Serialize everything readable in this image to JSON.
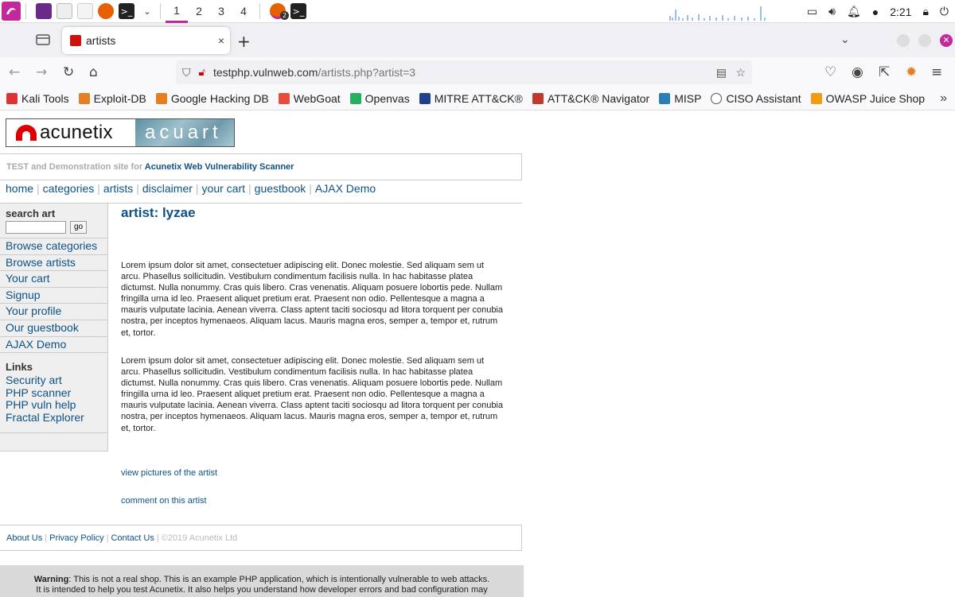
{
  "taskbar": {
    "workspaces": [
      "1",
      "2",
      "3",
      "4"
    ],
    "firefox_badge": "2",
    "clock": "2:21"
  },
  "browser": {
    "tab_title": "artists",
    "tab_close": "×",
    "new_tab": "+",
    "url_host": "testphp.vulnweb.com",
    "url_path": "/artists.php?artist=3"
  },
  "bookmarks": [
    {
      "label": "Kali Tools",
      "color": "#d33"
    },
    {
      "label": "Exploit-DB",
      "color": "#e67e22"
    },
    {
      "label": "Google Hacking DB",
      "color": "#e67e22"
    },
    {
      "label": "WebGoat",
      "color": "#e74c3c"
    },
    {
      "label": "Openvas",
      "color": "#27ae60"
    },
    {
      "label": "MITRE ATT&CK®",
      "color": "#1f3f8f"
    },
    {
      "label": "ATT&CK® Navigator",
      "color": "#c0392b"
    },
    {
      "label": "MISP",
      "color": "#2980b9"
    },
    {
      "label": "CISO Assistant",
      "color": "#555"
    },
    {
      "label": "OWASP Juice Shop",
      "color": "#f39c12"
    }
  ],
  "site": {
    "logo_left": "acunetix",
    "logo_right": "acuart",
    "tagline_prefix": "TEST and Demonstration site for ",
    "tagline_link": "Acunetix Web Vulnerability Scanner",
    "top_menu": [
      "home",
      "categories",
      "artists",
      "disclaimer",
      "your cart",
      "guestbook",
      "AJAX Demo"
    ],
    "search_title": "search art",
    "search_button": "go",
    "left_nav": [
      "Browse categories",
      "Browse artists",
      "Your cart",
      "Signup",
      "Your profile",
      "Our guestbook",
      "AJAX Demo"
    ],
    "links_title": "Links",
    "links": [
      "Security art",
      "PHP scanner",
      "PHP vuln help",
      "Fractal Explorer"
    ],
    "artist_heading": "artist: lyzae",
    "paragraph1": "Lorem ipsum dolor sit amet, consectetuer adipiscing elit. Donec molestie. Sed aliquam sem ut arcu. Phasellus sollicitudin. Vestibulum condimentum facilisis nulla. In hac habitasse platea dictumst. Nulla nonummy. Cras quis libero. Cras venenatis. Aliquam posuere lobortis pede. Nullam fringilla urna id leo. Praesent aliquet pretium erat. Praesent non odio. Pellentesque a magna a mauris vulputate lacinia. Aenean viverra. Class aptent taciti sociosqu ad litora torquent per conubia nostra, per inceptos hymenaeos. Aliquam lacus. Mauris magna eros, semper a, tempor et, rutrum et, tortor.",
    "paragraph2": "Lorem ipsum dolor sit amet, consectetuer adipiscing elit. Donec molestie. Sed aliquam sem ut arcu. Phasellus sollicitudin. Vestibulum condimentum facilisis nulla. In hac habitasse platea dictumst. Nulla nonummy. Cras quis libero. Cras venenatis. Aliquam posuere lobortis pede. Nullam fringilla urna id leo. Praesent aliquet pretium erat. Praesent non odio. Pellentesque a magna a mauris vulputate lacinia. Aenean viverra. Class aptent taciti sociosqu ad litora torquent per conubia nostra, per inceptos hymenaeos. Aliquam lacus. Mauris magna eros, semper a, tempor et, rutrum et, tortor.",
    "link_pictures": "view pictures of the artist",
    "link_comment": "comment on this artist",
    "footer_about": "About Us",
    "footer_privacy": "Privacy Policy",
    "footer_contact": "Contact Us",
    "footer_copyright": "©2019 Acunetix Ltd",
    "warning_label": "Warning",
    "warning_text": ": This is not a real shop. This is an example PHP application, which is intentionally vulnerable to web attacks.",
    "warning_text2": "It is intended to help you test Acunetix. It also helps you understand how developer errors and bad configuration may"
  }
}
